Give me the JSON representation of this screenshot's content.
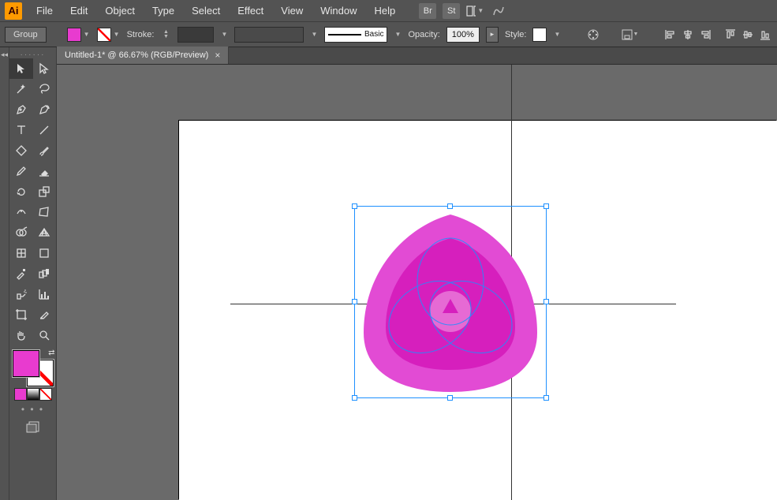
{
  "app": {
    "logo_text": "Ai"
  },
  "menu": {
    "items": [
      "File",
      "Edit",
      "Object",
      "Type",
      "Select",
      "Effect",
      "View",
      "Window",
      "Help"
    ],
    "right_buttons": {
      "br": "Br",
      "st": "St"
    }
  },
  "controls": {
    "selection_type": "Group",
    "stroke_label": "Stroke:",
    "stroke_weight": "",
    "brush_def_label": "Basic",
    "opacity_label": "Opacity:",
    "opacity_value": "100%",
    "style_label": "Style:"
  },
  "document": {
    "tab_title": "Untitled-1* @ 66.67% (RGB/Preview)",
    "tab_close": "×"
  },
  "colors": {
    "fill": "#e83bcf",
    "stroke": "none",
    "shape_outer": "#e24bd4",
    "shape_mid": "#d61fbd",
    "shape_inner": "#e66ad4",
    "selection_blue": "#1e90ff"
  }
}
